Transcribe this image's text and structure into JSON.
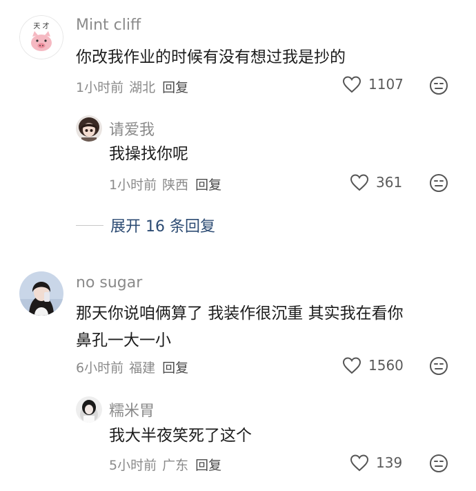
{
  "comments": [
    {
      "username": "Mint cliff",
      "text_lines": [
        "你改我作业的时候有没有想过我是抄的"
      ],
      "time": "1小时前",
      "location": "湖北",
      "reply_label": "回复",
      "likes": "1107",
      "avatar_text": "天 才",
      "reply": {
        "username": "请爱我",
        "text_lines": [
          "我操找你呢"
        ],
        "time": "1小时前",
        "location": "陕西",
        "reply_label": "回复",
        "likes": "361"
      },
      "expand_label": "展开 16 条回复"
    },
    {
      "username": "no sugar",
      "text_lines": [
        "那天你说咱俩算了 我装作很沉重 其实我在看你",
        "鼻孔一大一小"
      ],
      "time": "6小时前",
      "location": "福建",
      "reply_label": "回复",
      "likes": "1560",
      "reply": {
        "username": "糯米胃",
        "text_lines": [
          "我大半夜笑死了这个"
        ],
        "time": "5小时前",
        "location": "广东",
        "reply_label": "回复",
        "likes": "139"
      }
    }
  ],
  "icons": {
    "like": "heart-outline-icon",
    "dislike": "unamused-face-icon"
  },
  "colors": {
    "username": "#8a8a8a",
    "text": "#1c1c1c",
    "expand_link": "#2c4b73"
  }
}
